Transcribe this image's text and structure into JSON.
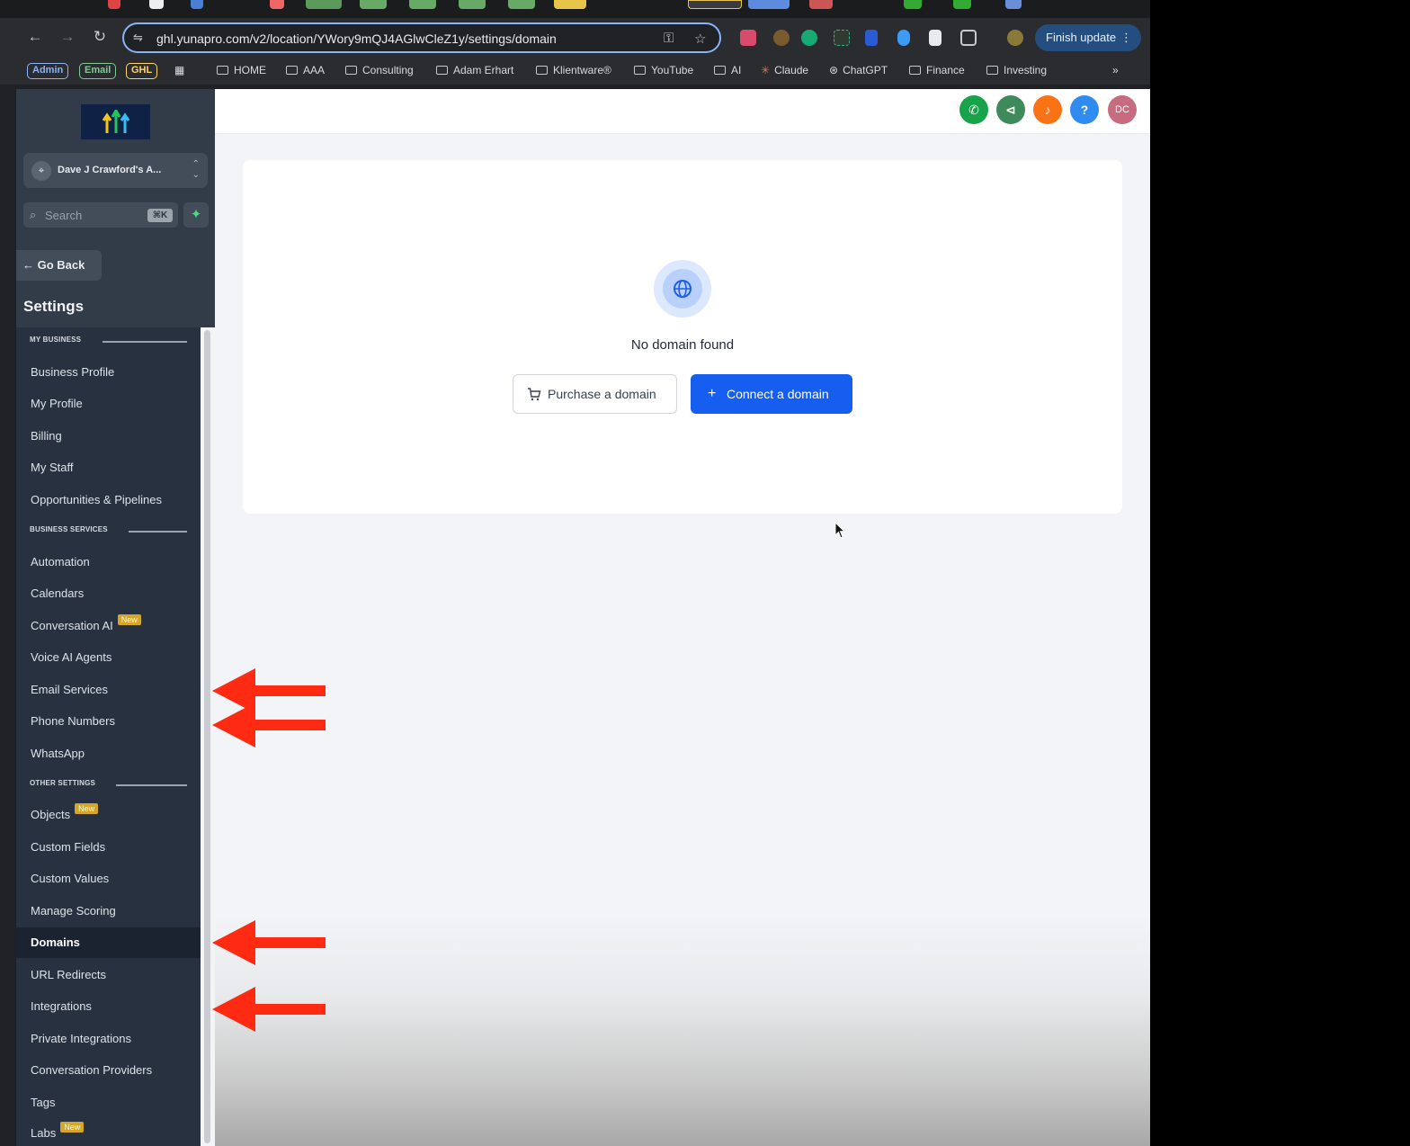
{
  "browser": {
    "url": "ghl.yunapro.com/v2/location/YWory9mQJ4AGlwCleZ1y/settings/domain",
    "finish_update": "Finish update",
    "bookmarks_chips": [
      {
        "label": "Admin",
        "color": "#8ab4f8"
      },
      {
        "label": "Email",
        "color": "#81c995"
      },
      {
        "label": "GHL",
        "color": "#fdd663"
      }
    ],
    "bookmarks": [
      "HOME",
      "AAA",
      "Consulting",
      "Adam Erhart",
      "Klientware®",
      "YouTube",
      "AI",
      "Claude",
      "ChatGPT",
      "Finance",
      "Investing"
    ],
    "more": "»"
  },
  "sidebar": {
    "account_name": "Dave J Crawford's A...",
    "search_placeholder": "Search",
    "search_shortcut": "⌘K",
    "go_back": "Go Back",
    "title": "Settings",
    "sections": {
      "my_business": "MY BUSINESS",
      "business_services": "BUSINESS SERVICES",
      "other_settings": "OTHER SETTINGS"
    },
    "items": {
      "business_profile": "Business Profile",
      "my_profile": "My Profile",
      "billing": "Billing",
      "my_staff": "My Staff",
      "opportunities": "Opportunities & Pipelines",
      "automation": "Automation",
      "calendars": "Calendars",
      "conversation_ai": "Conversation AI",
      "voice_ai": "Voice AI Agents",
      "email_services": "Email Services",
      "phone_numbers": "Phone Numbers",
      "whatsapp": "WhatsApp",
      "objects": "Objects",
      "custom_fields": "Custom Fields",
      "custom_values": "Custom Values",
      "manage_scoring": "Manage Scoring",
      "domains": "Domains",
      "url_redirects": "URL Redirects",
      "integrations": "Integrations",
      "private_integrations": "Private Integrations",
      "conversation_providers": "Conversation Providers",
      "tags": "Tags",
      "labs": "Labs"
    },
    "new_badge": "New",
    "active_item": "Domains"
  },
  "header": {
    "avatar_initials": "DC",
    "help": "?"
  },
  "main": {
    "empty_state": "No domain found",
    "purchase_button": "Purchase a domain",
    "connect_button": "Connect a domain",
    "connect_plus": "+"
  },
  "colors": {
    "primary": "#155eef",
    "sidebar": "#28313f",
    "annotation_arrow": "#ff2a12"
  }
}
